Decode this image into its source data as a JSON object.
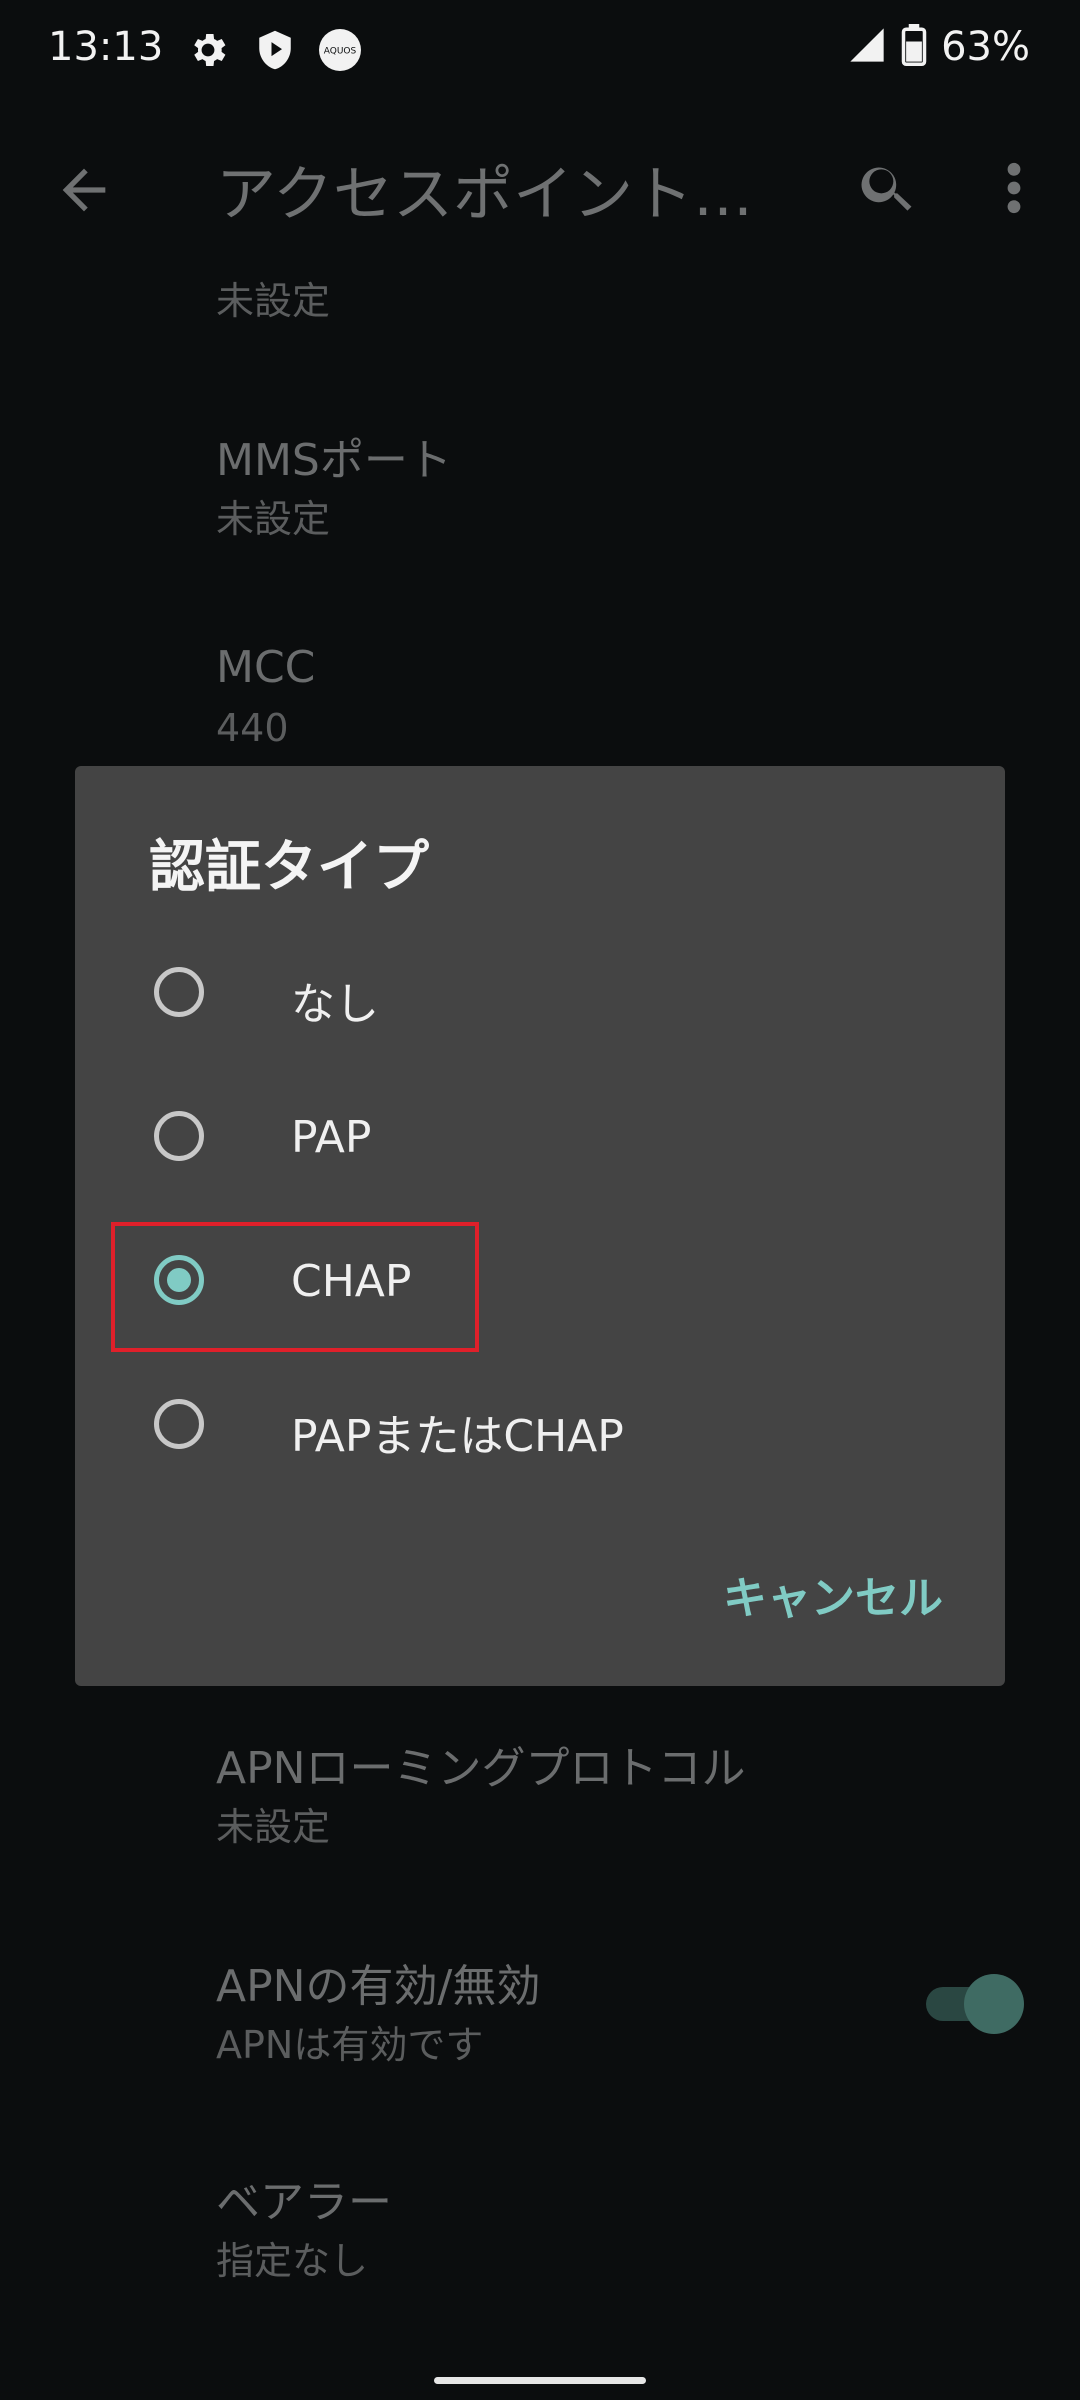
{
  "status_bar": {
    "time": "13:13",
    "battery": "63%",
    "icons": [
      "gear-icon",
      "shield-play-icon",
      "aquos-icon",
      "signal-icon",
      "battery-icon"
    ],
    "aquos_text": "AQUOS"
  },
  "app_bar": {
    "title": "アクセスポイント…",
    "icons": [
      "back-arrow-icon",
      "search-icon",
      "more-vert-icon"
    ]
  },
  "background_list": {
    "top_summary": "未設定",
    "items": [
      {
        "title": "MMSポート",
        "summary": "未設定"
      },
      {
        "title": "MCC",
        "summary": "440"
      },
      {
        "title": "APNローミングプロトコル",
        "summary": "未設定"
      },
      {
        "title": "APNの有効/無効",
        "summary": "APNは有効です"
      },
      {
        "title": "ベアラー",
        "summary": "指定なし"
      }
    ],
    "apn_toggle_on": true
  },
  "dialog": {
    "title": "認証タイプ",
    "options": [
      {
        "label": "なし",
        "checked": false
      },
      {
        "label": "PAP",
        "checked": false
      },
      {
        "label": "CHAP",
        "checked": true
      },
      {
        "label": "PAPまたはCHAP",
        "checked": false
      }
    ],
    "cancel_label": "キャンセル"
  },
  "colors": {
    "accent": "#80cbc4",
    "dialog_bg": "#444444",
    "background": "#0b0d0e",
    "highlight": "#e0202a"
  }
}
